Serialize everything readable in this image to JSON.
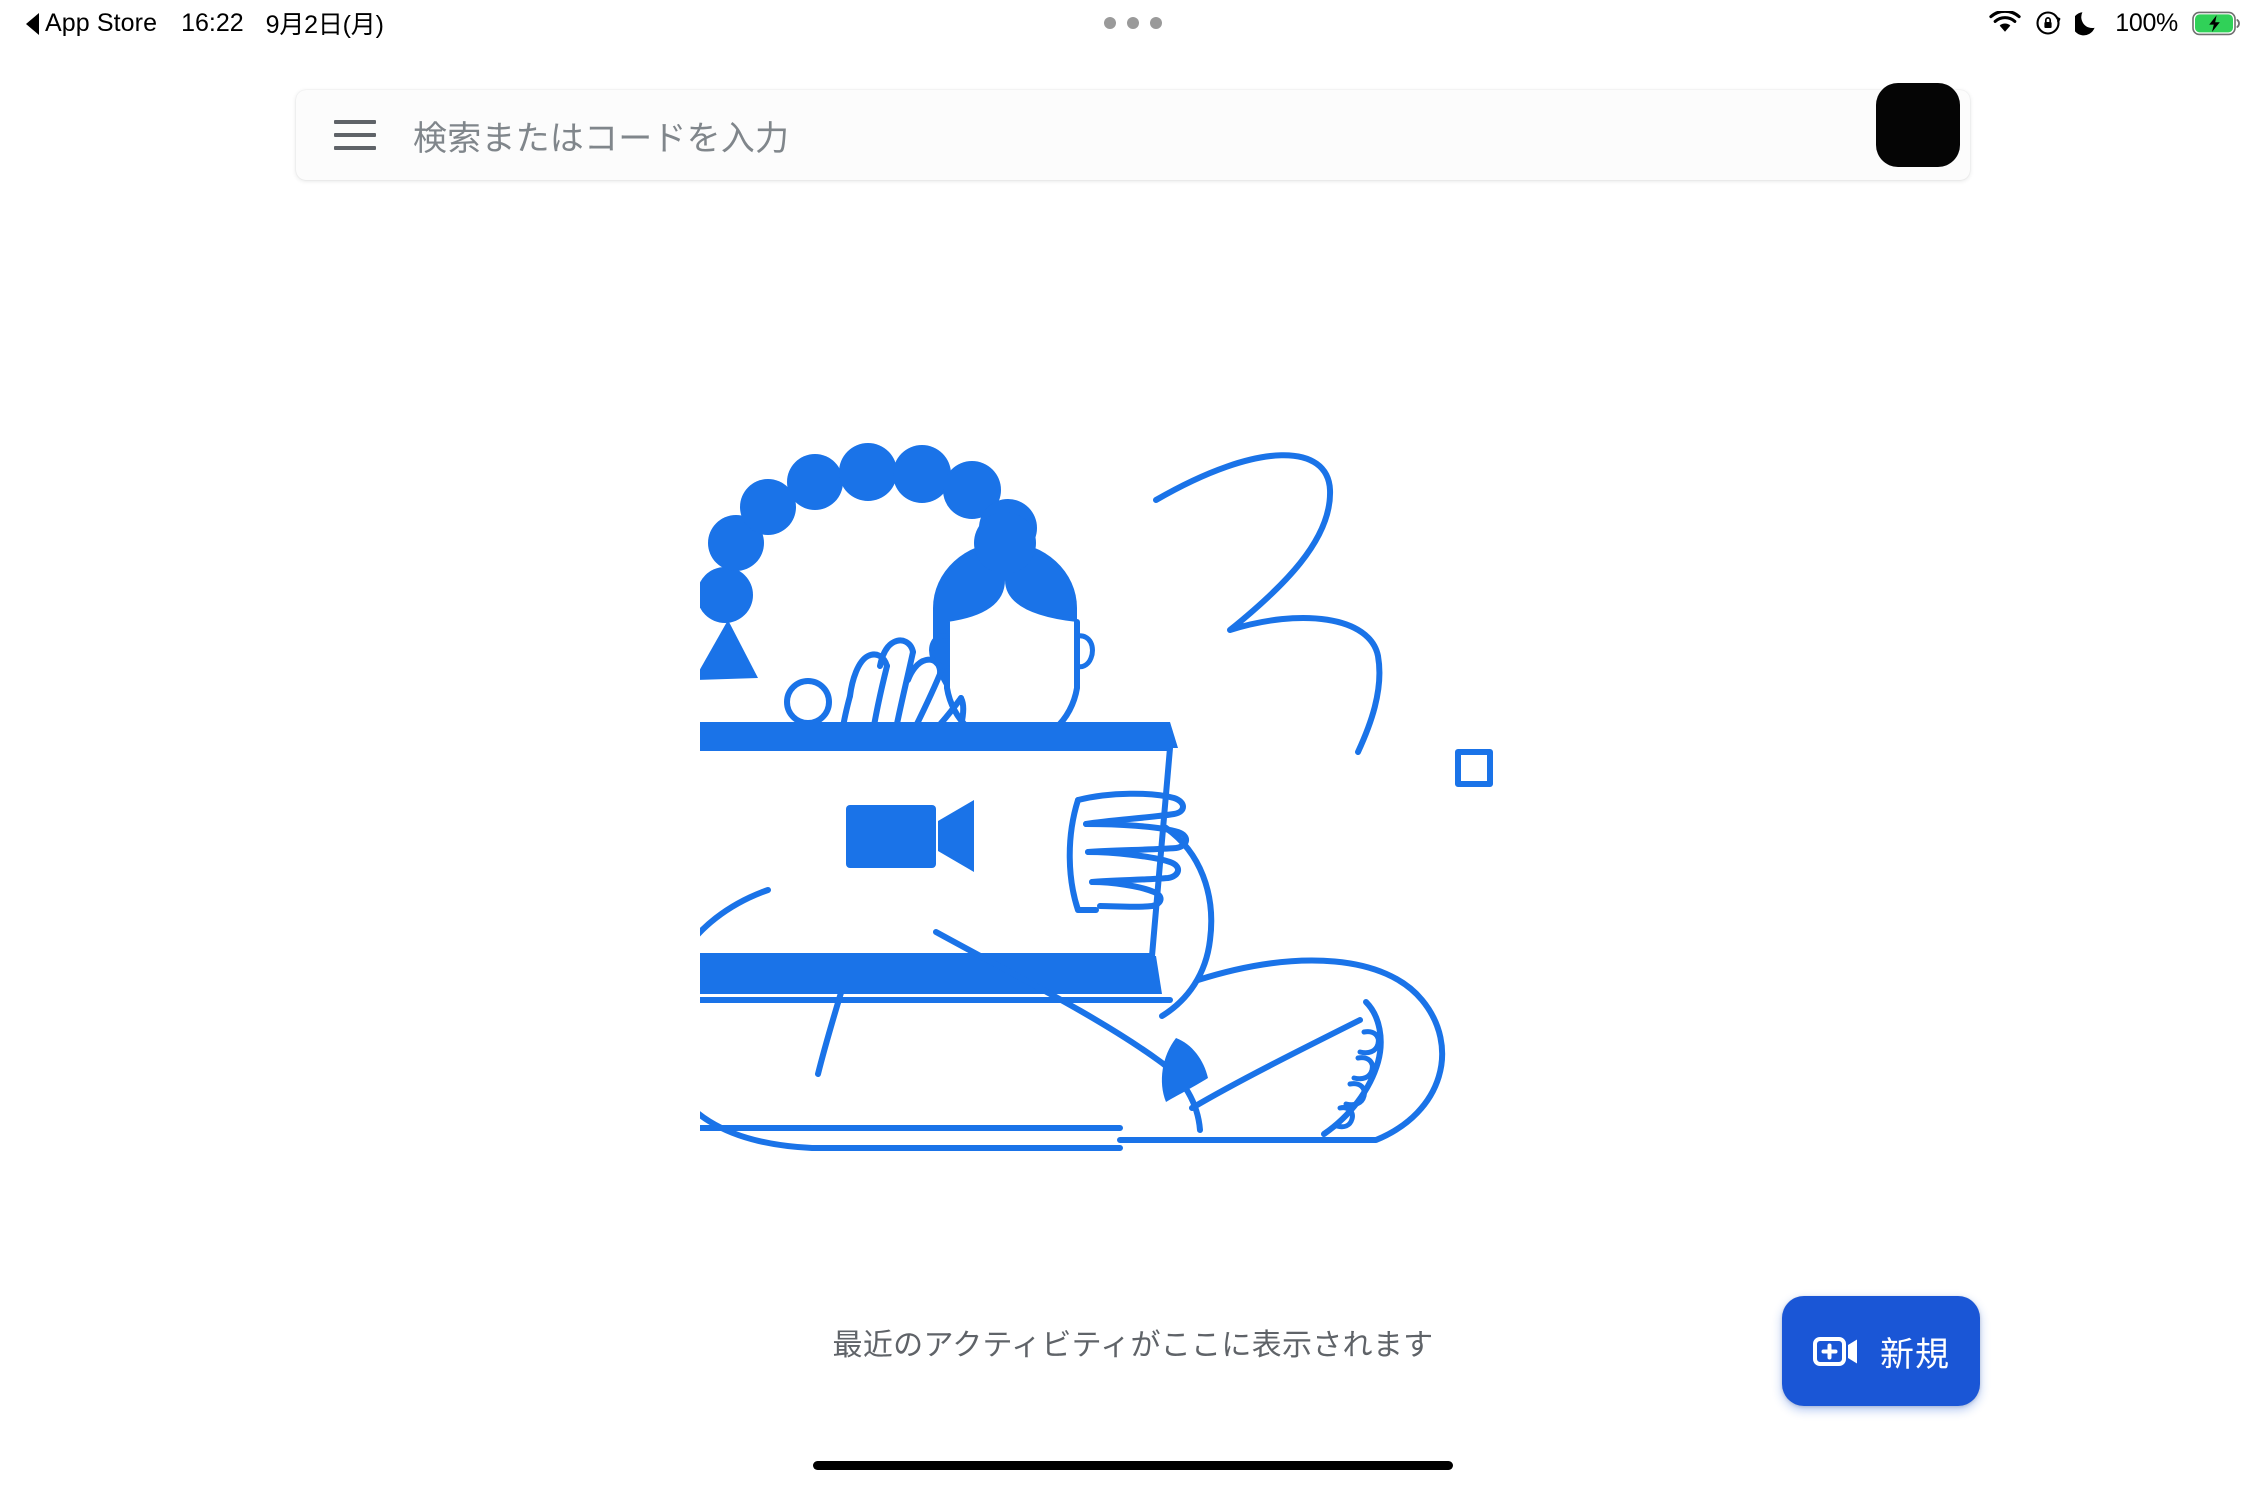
{
  "status_bar": {
    "back_label": "App Store",
    "back_icon": "back-triangle-icon",
    "clock": "16:22",
    "date": "9月2日(月)",
    "multitask_handle_icon": "three-dots-icon",
    "wifi_icon": "wifi-icon",
    "rotation_lock_icon": "rotation-lock-icon",
    "do_not_disturb_icon": "moon-icon",
    "battery_percent": "100%",
    "battery_icon": "battery-charging-icon",
    "battery_color": "#30d158"
  },
  "search": {
    "menu_icon": "hamburger-menu-icon",
    "placeholder": "検索またはコードを入力",
    "value": "",
    "avatar_label": "account-avatar"
  },
  "illustration": {
    "name": "person-waving-at-laptop-illustration",
    "line_color": "#1a73e8",
    "fill_color": "#1a73e8",
    "camera_icon": "video-camera-icon"
  },
  "main": {
    "empty_state_text": "最近のアクティビティがここに表示されます"
  },
  "fab": {
    "label": "新規",
    "icon": "new-video-call-icon",
    "color": "#1a56d6"
  },
  "system": {
    "home_indicator": "home-indicator-bar"
  }
}
